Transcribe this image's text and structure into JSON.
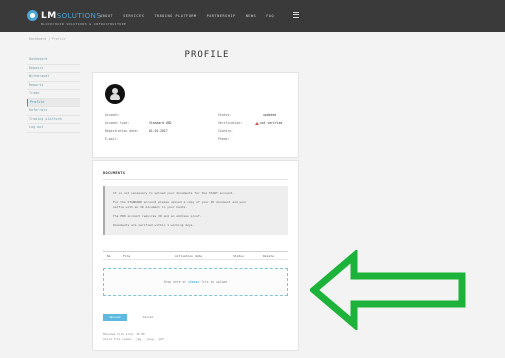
{
  "brand": {
    "name": "LM",
    "suffix": "SOLUTIONS",
    "tagline": "BLOCKCHAIN SOLUTIONS & INFRASTRUCTURE"
  },
  "nav": {
    "items": [
      "ABOUT",
      "SERVICES",
      "TRADING PLATFORM",
      "PARTNERSHIP",
      "NEWS",
      "FAQ"
    ]
  },
  "breadcrumb": "Dashboard / Profile",
  "sidebar": {
    "items": [
      {
        "label": "Dashboard"
      },
      {
        "label": "Deposit"
      },
      {
        "label": "Withdrawal"
      },
      {
        "label": "Reports"
      },
      {
        "label": "Trade"
      },
      {
        "label": "Profile"
      },
      {
        "label": "Referrals"
      },
      {
        "label": "Trading platform"
      },
      {
        "label": "Log out"
      }
    ],
    "active_index": 5
  },
  "page_title": "PROFILE",
  "profile": {
    "account_label": "Account:",
    "account_value": "",
    "account_type_label": "Account type:",
    "account_type_value": "Standard USD",
    "reg_date_label": "Registration date:",
    "reg_date_value": "01.01.2017",
    "email_label": "E-mail:",
    "email_value": "",
    "status_label": "Status:",
    "status_value": "updated",
    "verification_label": "Verification:",
    "verification_value": "not verified",
    "country_label": "Country:",
    "country_value": "",
    "phone_label": "Phone:",
    "phone_value": ""
  },
  "documents": {
    "title": "DOCUMENTS",
    "info_lines": [
      "It is not necessary to upload your documents for the START account.",
      "For the STANDARD account please upload a copy of your ID document and your",
      "selfie with an ID document in your hands.",
      "The PRO account requires ID and an address proof.",
      "Documents are verified within 1 working days."
    ],
    "table_headers": [
      "No",
      "File",
      "Activation date",
      "Status",
      "Delete"
    ],
    "dropzone_text_a": "Drop here or ",
    "dropzone_link": "choose",
    "dropzone_text_b": " file to upload",
    "upload_label": "Upload",
    "cancel_label": "Cancel",
    "max_size": "Maximum file size: 10 Mb",
    "file_types": "Valid file types: .jpg, .jpeg, .pdf"
  },
  "colors": {
    "accent": "#2d9ac8",
    "topbar": "#3a3a3a",
    "arrow": "#1db33a",
    "warning": "#d9534f"
  }
}
